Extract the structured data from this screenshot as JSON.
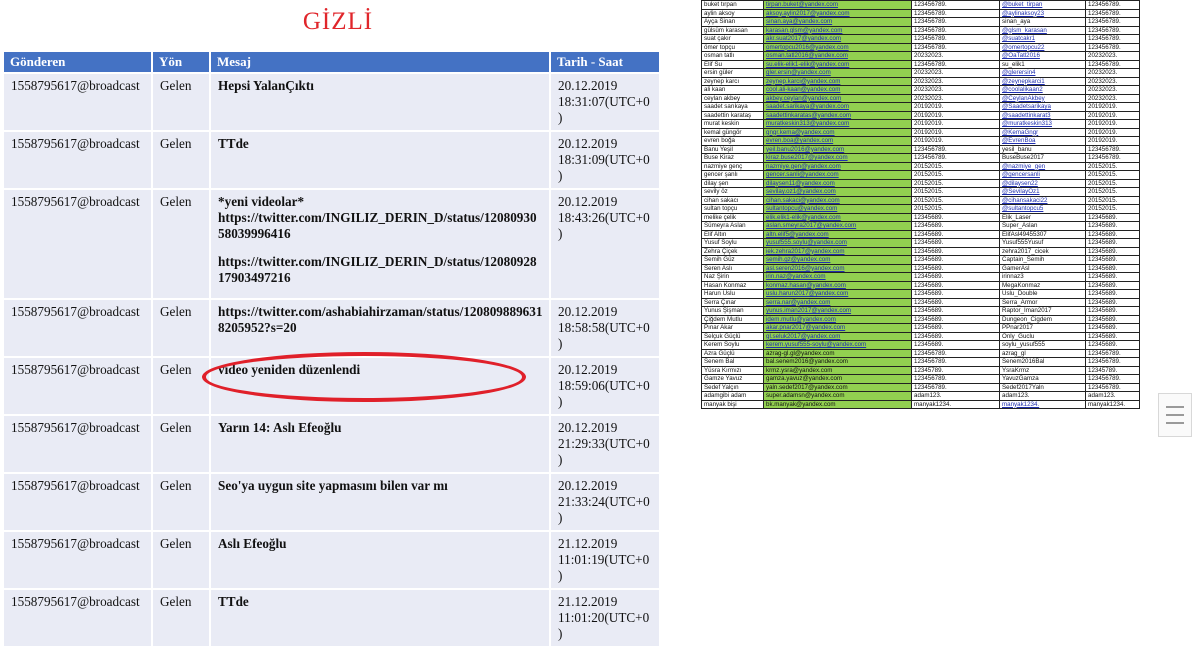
{
  "stamp": "GİZLİ",
  "messages": {
    "headers": [
      "Gönderen",
      "Yön",
      "Mesaj",
      "Tarih - Saat"
    ],
    "rows": [
      {
        "sender": "1558795617@broadcast",
        "direction": "Gelen",
        "message": [
          "Hepsi YalanÇıktı"
        ],
        "date": "20.12.2019 18:31:07(UTC+0)"
      },
      {
        "sender": "1558795617@broadcast",
        "direction": "Gelen",
        "message": [
          "TTde"
        ],
        "date": "20.12.2019 18:31:09(UTC+0)"
      },
      {
        "sender": "1558795617@broadcast",
        "direction": "Gelen",
        "message": [
          "*yeni videolar* https://twitter.com/INGILIZ_DERIN_D/status/1208093058039996416",
          "https://twitter.com/INGILIZ_DERIN_D/status/1208092817903497216"
        ],
        "date": "20.12.2019 18:43:26(UTC+0)"
      },
      {
        "sender": "1558795617@broadcast",
        "direction": "Gelen",
        "message": [
          "https://twitter.com/ashabiahirzaman/status/1208098896318205952?s=20"
        ],
        "date": "20.12.2019 18:58:58(UTC+0)"
      },
      {
        "sender": "1558795617@broadcast",
        "direction": "Gelen",
        "message": [
          "video yeniden düzenlendi"
        ],
        "date": "20.12.2019 18:59:06(UTC+0)"
      },
      {
        "sender": "1558795617@broadcast",
        "direction": "Gelen",
        "message": [
          "Yarın 14: Aslı Efeoğlu"
        ],
        "date": "20.12.2019 21:29:33(UTC+0)"
      },
      {
        "sender": "1558795617@broadcast",
        "direction": "Gelen",
        "message": [
          "Seo'ya uygun site yapmasını bilen var mı"
        ],
        "date": "20.12.2019 21:33:24(UTC+0)"
      },
      {
        "sender": "1558795617@broadcast",
        "direction": "Gelen",
        "message": [
          "Aslı Efeoğlu"
        ],
        "date": "21.12.2019 11:01:19(UTC+0)"
      },
      {
        "sender": "1558795617@broadcast",
        "direction": "Gelen",
        "message": [
          "TTde"
        ],
        "date": "21.12.2019 11:01:20(UTC+0)"
      }
    ]
  },
  "accounts": [
    {
      "name": "buket tırpan",
      "email": "tirpan.buket@yandex.com",
      "pass": "123456789.",
      "handle": "@buket_tirpan",
      "pass2": "123456789."
    },
    {
      "name": "aylin aksoy",
      "email": "aksoy.aylin2017@yandex.com",
      "pass": "123456789.",
      "handle": "@aylinaksoy23",
      "pass2": "123456789."
    },
    {
      "name": "Ayça Sinan",
      "email": "sinan.aya@yandex.com",
      "pass": "123456789.",
      "handle": "sinan_aya",
      "pass2": "123456789."
    },
    {
      "name": "gülsüm karasan",
      "email": "karasan.glsm@yandex.com",
      "pass": "123456789.",
      "handle": "@glsm_karasan",
      "pass2": "123456789."
    },
    {
      "name": "suat çakır",
      "email": "akr.suat2017@yandex.com",
      "pass": "123456789.",
      "handle": "@suatcakr1",
      "pass2": "123456789."
    },
    {
      "name": "ömer topçu",
      "email": "omertopcu2016@yandex.com",
      "pass": "123456789.",
      "handle": "@omertopcu22",
      "pass2": "123456789."
    },
    {
      "name": "osman tatlı",
      "email": "osman.tatl2016@yandex.com",
      "pass": "20232023.",
      "handle": "@OaTatl2016",
      "pass2": "20232023."
    },
    {
      "name": "Elif Su",
      "email": "su.elik-elik1-elik@yandex.com",
      "pass": "123456789.",
      "handle": "su_elik1",
      "pass2": "123456789."
    },
    {
      "name": "ersin güler",
      "email": "gler.ersin@yandex.com",
      "pass": "20232023.",
      "handle": "@glerersin4",
      "pass2": "20232023."
    },
    {
      "name": "zeynep karcı",
      "email": "zeynep.karci@yandex.com",
      "pass": "20232023.",
      "handle": "@zeynepkarci1",
      "pass2": "20232023."
    },
    {
      "name": "ali kaan",
      "email": "cool.ali-kaan@yandex.com",
      "pass": "20232023.",
      "handle": "@coolalikaan2",
      "pass2": "20232023."
    },
    {
      "name": "ceylan akbey",
      "email": "akbey.ceylan@yandex.com",
      "pass": "20232023.",
      "handle": "@CeylanAkbey",
      "pass2": "20232023."
    },
    {
      "name": "saadet sarıkaya",
      "email": "saadet.sarikaya@yandex.com",
      "pass": "20192019.",
      "handle": "@Saadetsarikaya",
      "pass2": "20192019."
    },
    {
      "name": "saadettin karataş",
      "email": "saadettinkaratas@yandex.com",
      "pass": "20192019.",
      "handle": "@saadettinkarat3",
      "pass2": "20192019."
    },
    {
      "name": "murat keskin",
      "email": "muratkeskin313@yandex.com",
      "pass": "20192019.",
      "handle": "@muratkeskin313",
      "pass2": "20192019."
    },
    {
      "name": "kemal güngör",
      "email": "gngr.kema@yandex.com",
      "pass": "20192019.",
      "handle": "@KemaGngr",
      "pass2": "20192019."
    },
    {
      "name": "evren boğa",
      "email": "evren.boa@yandex.com",
      "pass": "20192019.",
      "handle": "@EvrenBoa",
      "pass2": "20192019."
    },
    {
      "name": "Banu Yeşil",
      "email": "yeil.banu2016@yandex.com",
      "pass": "123456789.",
      "handle": "yesil_banu",
      "pass2": "123456789."
    },
    {
      "name": "Buse Kiraz",
      "email": "kiraz.buse2017@yandex.com",
      "pass": "123456789.",
      "handle": "BuseBuse2017",
      "pass2": "123456789."
    },
    {
      "name": "nazmiye genç",
      "email": "nazmiye.gen@yandex.com",
      "pass": "20152015.",
      "handle": "@nazmiye_gen",
      "pass2": "20152015."
    },
    {
      "name": "gencer şanlı",
      "email": "gencer.sanli@yandex.com",
      "pass": "20152015.",
      "handle": "@gencersanli",
      "pass2": "20152015."
    },
    {
      "name": "dilay şen",
      "email": "dilaysen11@yandex.com",
      "pass": "20152015.",
      "handle": "@dilaysen22",
      "pass2": "20152015."
    },
    {
      "name": "sevily öz",
      "email": "sevilay.oz1@yandex.com",
      "pass": "20152015.",
      "handle": "@SevilayOz1",
      "pass2": "20152015."
    },
    {
      "name": "cihan sakacı",
      "email": "cihan.sakaci@yandex.com",
      "pass": "20152015.",
      "handle": "@cihansakaci22",
      "pass2": "20152015."
    },
    {
      "name": "sultan topçu",
      "email": "sultantopcu@yandex.com",
      "pass": "20152015.",
      "handle": "@sultantopcu5",
      "pass2": "20152015."
    },
    {
      "name": "melike çelik",
      "email": "elik.elik1-elik@yandex.com",
      "pass": "12345689.",
      "handle": "Elik_Laser",
      "pass2": "12345689."
    },
    {
      "name": "Sümeyra Aslan",
      "email": "aslan.smeyra2017@yandex.com",
      "pass": "12345689.",
      "handle": "Super_Aslan",
      "pass2": "12345689."
    },
    {
      "name": "Elif Altın",
      "email": "altn.elif5@yandex.com",
      "pass": "12345689.",
      "handle": "ElifAsl49455307",
      "pass2": "12345689."
    },
    {
      "name": "Yusuf Soylu",
      "email": "yusuf555.soylu@yandex.com",
      "pass": "12345689.",
      "handle": "Yusuf555Yusuf",
      "pass2": "12345689."
    },
    {
      "name": "Zehra Çiçek",
      "email": "iek.zehra2017@yandex.com",
      "pass": "12345689.",
      "handle": "zehra2017_cicek",
      "pass2": "12345689."
    },
    {
      "name": "Semih Güz",
      "email": "semih.gz@yandex.com",
      "pass": "12345689.",
      "handle": "Captain_Semih",
      "pass2": "12345689."
    },
    {
      "name": "Seren Aslı",
      "email": "asl.seren2016@yandex.com",
      "pass": "12345689.",
      "handle": "GamerAsl",
      "pass2": "12345689."
    },
    {
      "name": "Naz Şirin",
      "email": "irin.naz@yandex.com",
      "pass": "12345689.",
      "handle": "irinnaz3",
      "pass2": "12345689."
    },
    {
      "name": "Hasan Konmaz",
      "email": "konmaz.hasan@yandex.com",
      "pass": "12345689.",
      "handle": "MegaKonmaz",
      "pass2": "12345689."
    },
    {
      "name": "Harun Uslu",
      "email": "uslu.harun2017@yandex.com",
      "pass": "12345689.",
      "handle": "Uslu_Double",
      "pass2": "12345689."
    },
    {
      "name": "Serra Çınar",
      "email": "serra.nar@yandex.com",
      "pass": "12345689.",
      "handle": "Serra_Armor",
      "pass2": "12345689."
    },
    {
      "name": "Yunus Şişman",
      "email": "yunus.iman2017@yandex.com",
      "pass": "12345689.",
      "handle": "Raptor_Iman2017",
      "pass2": "12345689."
    },
    {
      "name": "Çiğdem Mutlu",
      "email": "idem.mutlu@yandex.com",
      "pass": "12345689.",
      "handle": "Dungeon_Cigdem",
      "pass2": "12345689."
    },
    {
      "name": "Pınar Akar",
      "email": "akar.pnar2017@yandex.com",
      "pass": "12345689.",
      "handle": "PPnar2017",
      "pass2": "12345689."
    },
    {
      "name": "Selçuk Güçlü",
      "email": "gl.seluk2017@yandex.com",
      "pass": "12345689.",
      "handle": "Only_Guclu",
      "pass2": "12345689."
    },
    {
      "name": "Kerem Soylu",
      "email": "kerem.yusuf555-soylu@yandex.com",
      "pass": "12345689.",
      "handle": "soylu_yusuf555",
      "pass2": "12345689."
    },
    {
      "name": "Azra Güçlü",
      "email": "azrag-gl.gl@yandex.com",
      "pass": "123456789.",
      "handle": "azrag_gl",
      "pass2": "123456789."
    },
    {
      "name": "Senem Bal",
      "email": "bal.senem2016@yandex.com",
      "pass": "123456789.",
      "handle": "Senem2016Bal",
      "pass2": "123456789."
    },
    {
      "name": "Yüsra Kırmızı",
      "email": "krmz.ysra@yandex.com",
      "pass": "12345789.",
      "handle": "YsraKrmz",
      "pass2": "12345789."
    },
    {
      "name": "Gamze Yavuz",
      "email": "gamza.yavuz@yandex.com",
      "pass": "123456789.",
      "handle": "YavuzGamza",
      "pass2": "123456789."
    },
    {
      "name": "Sedef Yalçın",
      "email": "yaln.sedef2017@yandex.com",
      "pass": "123456789.",
      "handle": "Sedef2017Yaln",
      "pass2": "123456789."
    },
    {
      "name": "adamgibi adam",
      "email": "super.adamsn@yandex.com",
      "pass": "adam123.",
      "handle": "adam123.",
      "pass2": "adam123."
    },
    {
      "name": "manyak bişi",
      "email": "bk.manyak@yandex.com",
      "pass": "manyak1234.",
      "handle": "manyak1234.",
      "pass2": "manyak1234."
    }
  ],
  "plain_email_from": 41,
  "plain_handles": [
    2,
    7,
    17,
    18,
    25,
    26,
    27,
    28,
    29,
    30,
    31,
    32,
    33,
    34,
    35,
    36,
    37,
    38,
    39,
    40,
    41,
    42,
    43,
    44,
    45,
    46
  ],
  "highlight": {
    "color": "#e0202a",
    "row_index": 6
  },
  "colors": {
    "header_bg": "#4472c4",
    "row_bg": "#e9ebf5",
    "email_bg": "#92d050",
    "stamp": "#e0262b"
  },
  "icons": [
    "menu-lines-icon"
  ]
}
